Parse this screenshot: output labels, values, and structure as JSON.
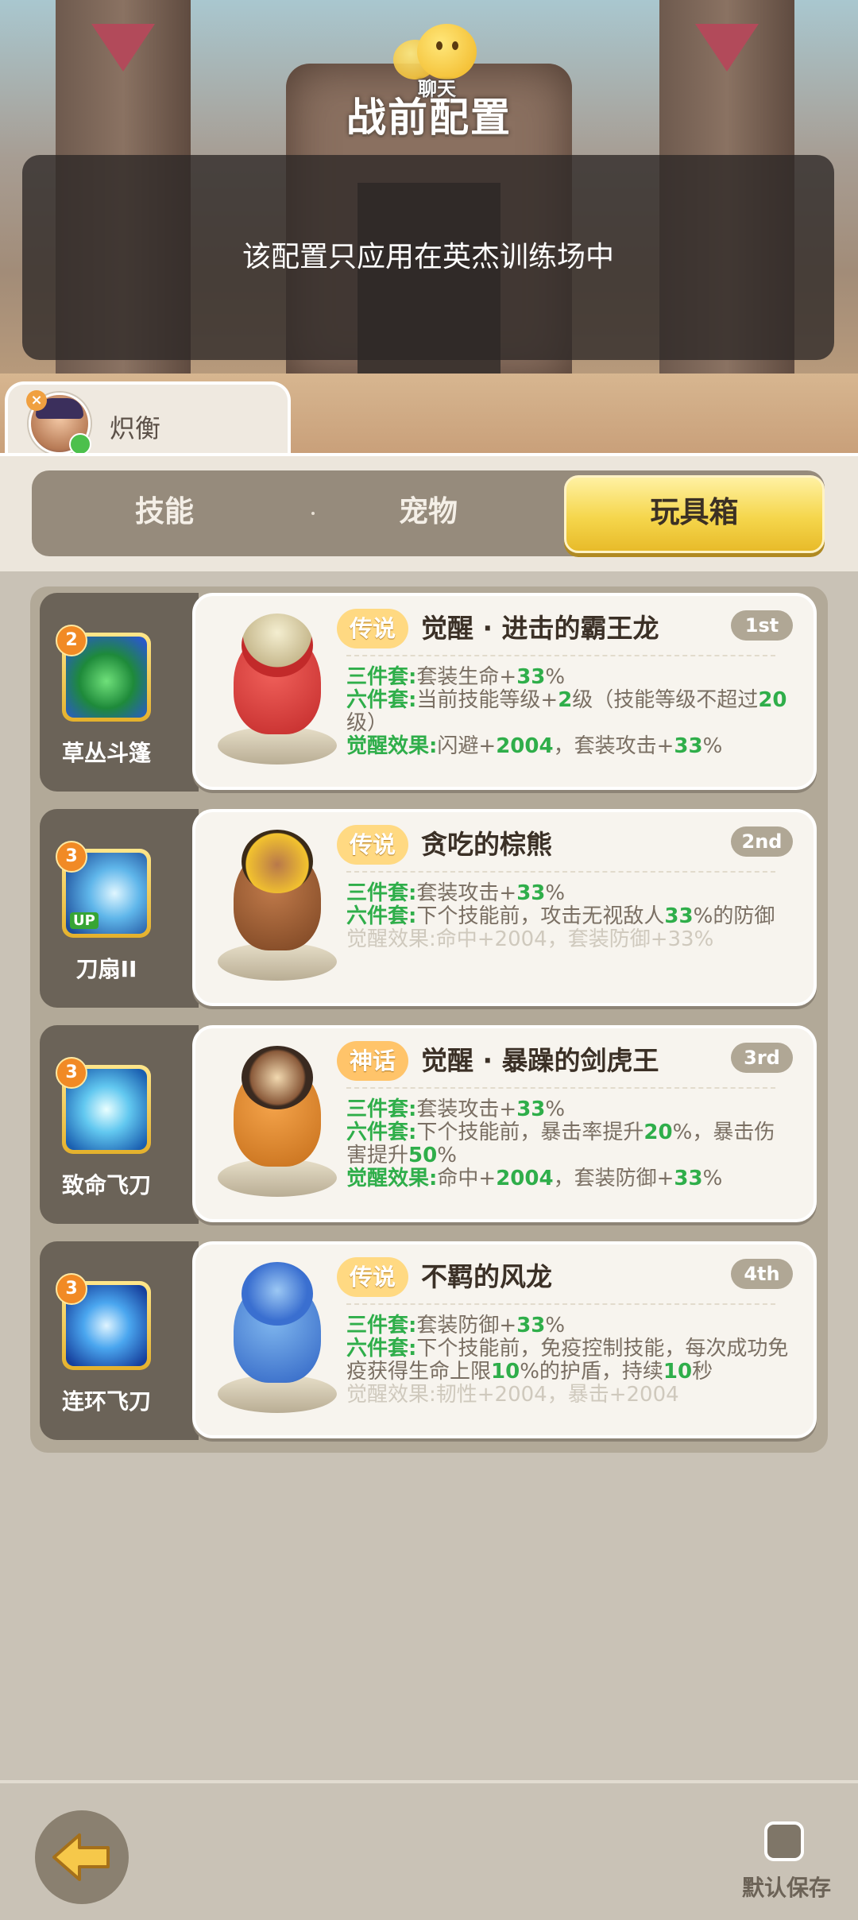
{
  "header": {
    "chat_label": "聊天",
    "title": "战前配置",
    "notice": "该配置只应用在英杰训练场中"
  },
  "player": {
    "name": "炽衡"
  },
  "tabs": [
    {
      "label": "技能",
      "active": false
    },
    {
      "label": "宠物",
      "active": false
    },
    {
      "label": "玩具箱",
      "active": true
    }
  ],
  "toys": [
    {
      "skill": {
        "name": "草丛斗篷",
        "level": "2",
        "up": false
      },
      "rarity": "传说",
      "name": "觉醒 · 进击的霸王龙",
      "rank": "1st",
      "lines": [
        {
          "key": "三件套:",
          "text": "套装生命+",
          "value": "33",
          "suffix": "%",
          "dim": false
        },
        {
          "key": "六件套:",
          "text": "当前技能等级+",
          "value": "2",
          "suffix": "级（技能等级不超过",
          "value2": "20",
          "suffix2": "级）",
          "dim": false
        },
        {
          "key": "觉醒效果:",
          "text": "闪避+",
          "value": "2004",
          "suffix": "，套装攻击+",
          "value2": "33",
          "suffix2": "%",
          "dim": false
        }
      ]
    },
    {
      "skill": {
        "name": "刀扇II",
        "level": "3",
        "up": true,
        "up_label": "UP"
      },
      "rarity": "传说",
      "name": "贪吃的棕熊",
      "rank": "2nd",
      "lines": [
        {
          "key": "三件套:",
          "text": "套装攻击+",
          "value": "33",
          "suffix": "%",
          "dim": false
        },
        {
          "key": "六件套:",
          "text": "下个技能前，攻击无视敌人",
          "value": "33",
          "suffix": "%的防御",
          "dim": false
        },
        {
          "key": "觉醒效果:",
          "text": "命中+2004，套装防御+33%",
          "value": "",
          "suffix": "",
          "dim": true
        }
      ]
    },
    {
      "skill": {
        "name": "致命飞刀",
        "level": "3",
        "up": false
      },
      "rarity": "神话",
      "name": "觉醒 · 暴躁的剑虎王",
      "rank": "3rd",
      "lines": [
        {
          "key": "三件套:",
          "text": "套装攻击+",
          "value": "33",
          "suffix": "%",
          "dim": false
        },
        {
          "key": "六件套:",
          "text": "下个技能前，暴击率提升",
          "value": "20",
          "suffix": "%，暴击伤害提升",
          "value2": "50",
          "suffix2": "%",
          "dim": false
        },
        {
          "key": "觉醒效果:",
          "text": "命中+",
          "value": "2004",
          "suffix": "，套装防御+",
          "value2": "33",
          "suffix2": "%",
          "dim": false
        }
      ]
    },
    {
      "skill": {
        "name": "连环飞刀",
        "level": "3",
        "up": false
      },
      "rarity": "传说",
      "name": "不羁的风龙",
      "rank": "4th",
      "lines": [
        {
          "key": "三件套:",
          "text": "套装防御+",
          "value": "33",
          "suffix": "%",
          "dim": false
        },
        {
          "key": "六件套:",
          "text": "下个技能前，免疫控制技能，每次成功免疫获得生命上限",
          "value": "10",
          "suffix": "%的护盾，持续",
          "value2": "10",
          "suffix2": "秒",
          "dim": false
        },
        {
          "key": "觉醒效果:",
          "text": "韧性+2004，暴击+2004",
          "value": "",
          "suffix": "",
          "dim": true
        }
      ]
    }
  ],
  "footer": {
    "save_label": "默认保存",
    "save_checked": false
  },
  "colors": {
    "highlight_green": "#2fae4a",
    "tab_active": "#f5d64c",
    "rarity_badge": "#ffd982"
  }
}
